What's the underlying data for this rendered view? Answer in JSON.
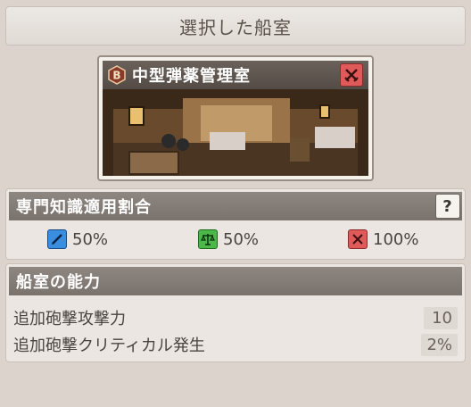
{
  "header": {
    "title": "選択した船室"
  },
  "room": {
    "badge": "B",
    "name": "中型弾薬管理室",
    "type_icon": "crossed-swords-icon"
  },
  "expertise": {
    "title": "専門知識適用割合",
    "help_label": "?",
    "ratios": [
      {
        "icon": "pen-icon",
        "color": "#3a8ee0",
        "value": "50%"
      },
      {
        "icon": "scales-icon",
        "color": "#4cb84a",
        "value": "50%"
      },
      {
        "icon": "crossed-swords-icon",
        "color": "#e05a5a",
        "value": "100%"
      }
    ]
  },
  "abilities": {
    "title": "船室の能力",
    "rows": [
      {
        "label": "追加砲撃攻撃力",
        "value": "10"
      },
      {
        "label": "追加砲撃クリティカル発生",
        "value": "2%"
      }
    ]
  }
}
